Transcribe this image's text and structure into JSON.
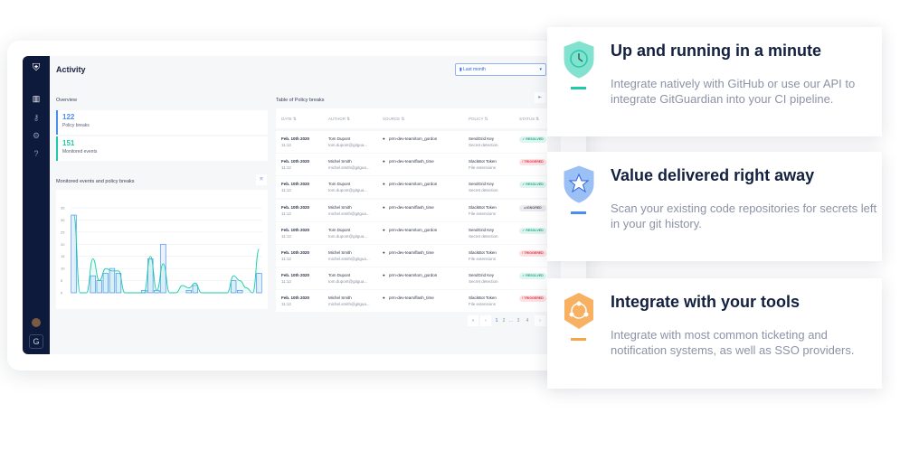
{
  "app": {
    "title": "Activity",
    "period": "Last month",
    "overview_label": "Overview",
    "stats": [
      {
        "value": "122",
        "label": "Policy breaks",
        "color": "#4a8ef0"
      },
      {
        "value": "151",
        "label": "Monitored events",
        "color": "#1ecaa8"
      }
    ],
    "chart_label": "Monitored events and policy breaks",
    "table_label": "Table of Policy breaks",
    "columns": [
      "DATE ⇅",
      "AUTHOR ⇅",
      "SOURCE ⇅",
      "POLICY ⇅",
      "STATUS ⇅"
    ],
    "rows": [
      {
        "date": "Feb. 10th 2020",
        "time": "11:12",
        "author": "Tom Dupont",
        "email": "tom.dupont@gitgua...",
        "source": "prm-dev-team/tom_gordon",
        "policy": "SendGrid Key",
        "ptype": "Secret detection",
        "status": "✓ RESOLVED",
        "kind": "ok"
      },
      {
        "date": "Feb. 10th 2020",
        "time": "11:12",
        "author": "Michel Smith",
        "email": "michel.smith@gitgua...",
        "source": "prm-dev-team/flash_time",
        "policy": "SlackBot Token",
        "ptype": "File extensions",
        "status": "! TRIGGERED",
        "kind": "bad"
      },
      {
        "date": "Feb. 10th 2020",
        "time": "11:12",
        "author": "Tom Dupont",
        "email": "tom.dupont@gitgua...",
        "source": "prm-dev-team/tom_gordon",
        "policy": "SendGrid Key",
        "ptype": "Secret detection",
        "status": "✓ RESOLVED",
        "kind": "ok"
      },
      {
        "date": "Feb. 10th 2020",
        "time": "11:12",
        "author": "Michel Smith",
        "email": "michel.smith@gitgua...",
        "source": "prm-dev-team/flash_time",
        "policy": "SlackBot Token",
        "ptype": "File extensions",
        "status": "◂ IGNORED",
        "kind": "ign"
      },
      {
        "date": "Feb. 10th 2020",
        "time": "11:12",
        "author": "Tom Dupont",
        "email": "tom.dupont@gitgua...",
        "source": "prm-dev-team/tom_gordon",
        "policy": "SendGrid Key",
        "ptype": "Secret detection",
        "status": "✓ RESOLVED",
        "kind": "ok"
      },
      {
        "date": "Feb. 10th 2020",
        "time": "11:12",
        "author": "Michel Smith",
        "email": "michel.smith@gitgua...",
        "source": "prm-dev-team/flash_time",
        "policy": "SlackBot Token",
        "ptype": "File extensions",
        "status": "! TRIGGERED",
        "kind": "bad"
      },
      {
        "date": "Feb. 10th 2020",
        "time": "11:12",
        "author": "Tom Dupont",
        "email": "tom.dupont@gitgua...",
        "source": "prm-dev-team/tom_gordon",
        "policy": "SendGrid Key",
        "ptype": "Secret detection",
        "status": "✓ RESOLVED",
        "kind": "ok"
      },
      {
        "date": "Feb. 10th 2020",
        "time": "11:12",
        "author": "Michel Smith",
        "email": "michel.smith@gitgua...",
        "source": "prm-dev-team/flash_time",
        "policy": "SlackBot Token",
        "ptype": "File extensions",
        "status": "! TRIGGERED",
        "kind": "bad"
      }
    ],
    "pagination": [
      "«",
      "‹",
      "1",
      "2",
      "...",
      "3",
      "4",
      "›"
    ],
    "avatar_letter": "G"
  },
  "chart_data": {
    "type": "bar",
    "title": "Monitored events and policy breaks",
    "ylim": [
      0,
      35
    ],
    "yticks": [
      0,
      5,
      10,
      15,
      20,
      25,
      30,
      35
    ],
    "x": [
      0,
      1,
      2,
      3,
      4,
      5,
      6,
      7,
      8,
      9,
      10,
      11,
      12,
      13,
      14,
      15,
      16,
      17,
      18,
      19,
      20,
      21,
      22,
      23,
      24,
      25,
      26,
      27,
      28,
      29
    ],
    "series": [
      {
        "name": "Policy breaks",
        "type": "bar",
        "color": "#4a8ef0",
        "values": [
          32,
          null,
          null,
          7,
          5,
          8,
          10,
          8,
          null,
          null,
          null,
          1,
          14,
          1,
          20,
          null,
          null,
          null,
          1,
          3,
          null,
          null,
          null,
          null,
          null,
          5,
          1,
          null,
          null,
          8
        ]
      },
      {
        "name": "Monitored events",
        "type": "line",
        "color": "#1ecaa8",
        "values": [
          32,
          0,
          0,
          14,
          5,
          10,
          9,
          9,
          0,
          0,
          0,
          0,
          15,
          1,
          12,
          0,
          0,
          3,
          2,
          4,
          0,
          0,
          0,
          0,
          0,
          7,
          5,
          2,
          0,
          18
        ]
      }
    ]
  },
  "features": [
    {
      "title": "Up and running in a minute",
      "text": "Integrate natively with GitHub or use our API to integrate GitGuardian into your CI pipeline.",
      "color": "#1ecaa8"
    },
    {
      "title": "Value delivered right away",
      "text": "Scan your existing code repositories for secrets left in your git history.",
      "color": "#4a8ef0"
    },
    {
      "title": "Integrate with your tools",
      "text": "Integrate with most common ticketing and notification systems, as well as SSO providers.",
      "color": "#f7a348"
    }
  ]
}
